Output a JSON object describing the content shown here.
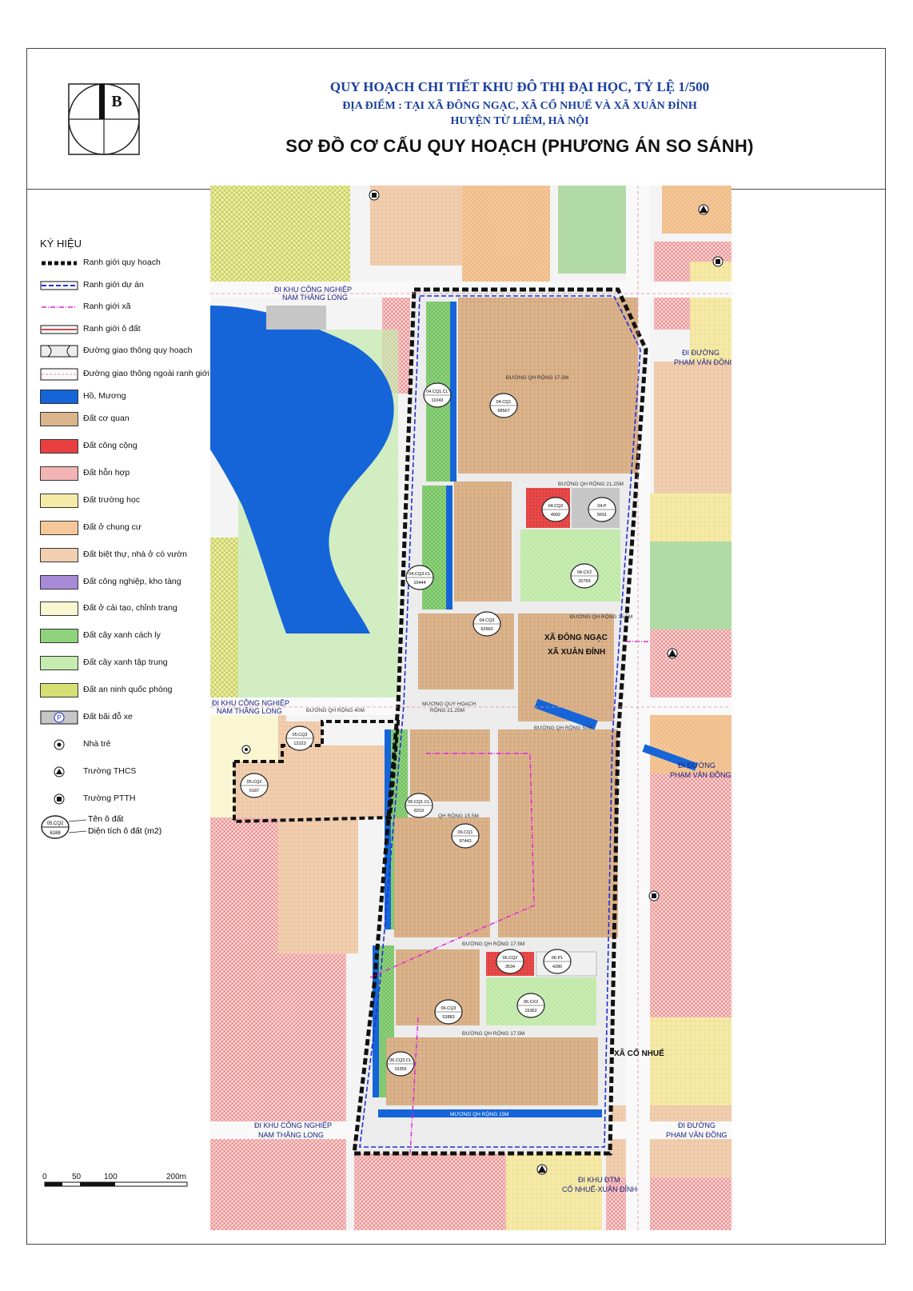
{
  "header": {
    "logo_letter": "B",
    "title_line1": "QUY HOẠCH CHI TIẾT KHU ĐÔ THỊ ĐẠI HỌC, TỶ LỆ 1/500",
    "title_line2": "ĐỊA ĐIỂM : TẠI XÃ ĐÔNG NGẠC, XÃ CỔ NHUẾ VÀ XÃ XUÂN ĐỈNH",
    "title_line3": "HUYỆN TỪ LIÊM, HÀ NỘI",
    "main_title": "SƠ ĐỒ CƠ CẤU QUY HOẠCH (PHƯƠNG ÁN SO SÁNH)"
  },
  "legend": {
    "title": "KÝ HIỆU",
    "items": [
      {
        "label": "Ranh giới quy hoạch",
        "icon": "boundary-planning"
      },
      {
        "label": "Ranh giới dự án",
        "icon": "boundary-project"
      },
      {
        "label": "Ranh giới xã",
        "icon": "boundary-commune"
      },
      {
        "label": "Ranh giới ô đất",
        "icon": "boundary-lot"
      },
      {
        "label": "Đường giao thông quy hoạch",
        "icon": "road-planned"
      },
      {
        "label": "Đường giao thông ngoài ranh giới",
        "icon": "road-outside"
      },
      {
        "label": "Hồ, Mương",
        "icon": "water"
      },
      {
        "label": "Đất cơ quan",
        "icon": "agency-land"
      },
      {
        "label": "Đất công cộng",
        "icon": "public-land"
      },
      {
        "label": "Đất hỗn hợp",
        "icon": "mixed-land"
      },
      {
        "label": "Đất trường học",
        "icon": "school-land"
      },
      {
        "label": "Đất ở chung cư",
        "icon": "apartment-land"
      },
      {
        "label": "Đất biệt thự, nhà ở có vườn",
        "icon": "villa-land"
      },
      {
        "label": "Đất công nghiệp, kho tàng",
        "icon": "industrial-land"
      },
      {
        "label": "Đất ở cải tạo, chỉnh trang",
        "icon": "renovation-land"
      },
      {
        "label": "Đất cây xanh cách ly",
        "icon": "green-buffer"
      },
      {
        "label": "Đất cây xanh tập trung",
        "icon": "green-park"
      },
      {
        "label": "Đất an ninh quốc phòng",
        "icon": "defense-land"
      },
      {
        "label": "Đất bãi đỗ xe",
        "icon": "parking"
      },
      {
        "label": "Nhà trẻ",
        "icon": "kindergarten"
      },
      {
        "label": "Trường THCS",
        "icon": "secondary-school"
      },
      {
        "label": "Trường PTTH",
        "icon": "high-school"
      }
    ],
    "lot_name_label": "Tên ô đất",
    "lot_area_label": "Diện tích ô đất (m2)",
    "sample_name": "05.CQ2",
    "sample_area": "6188"
  },
  "colors": {
    "title_blue": "#1a3f9e",
    "agency": "#dcb48c",
    "public": "#e84040",
    "mixed": "#f2b4b4",
    "school": "#f6eaa8",
    "apartment": "#f4c89a",
    "villa": "#f2cfb0",
    "industrial": "#a98ad8",
    "renovation": "#fbf6d2",
    "green_buffer": "#8ed37c",
    "green_park": "#c6ecb0",
    "defense": "#d6df74",
    "water": "#1565d8",
    "road": "#ececec"
  },
  "map": {
    "lots": [
      {
        "name": "04.CQ1.CL",
        "area": "11043"
      },
      {
        "name": "04.CQ1",
        "area": "68567"
      },
      {
        "name": "04.CQ2",
        "area": "4992"
      },
      {
        "name": "04.P",
        "area": "5691"
      },
      {
        "name": "04.CX2",
        "area": "20769"
      },
      {
        "name": "04.CQ3.CL",
        "area": "10444"
      },
      {
        "name": "04.CQ3",
        "area": "62660"
      },
      {
        "name": "05.CQ3",
        "area": "12223"
      },
      {
        "name": "05.CQ2",
        "area": "6187"
      },
      {
        "name": "06.CQ1.CL",
        "area": "8319"
      },
      {
        "name": "06.CQ1",
        "area": "97443"
      },
      {
        "name": "06.CQ2",
        "area": "3534"
      },
      {
        "name": "06.P1",
        "area": "4280"
      },
      {
        "name": "06.CX2",
        "area": "15362"
      },
      {
        "name": "06.CQ3",
        "area": "53883"
      },
      {
        "name": "06.CQ3.CL",
        "area": "15356"
      }
    ],
    "labels": {
      "to_industrial_1": "ĐI KHU CÔNG NGHIỆP",
      "to_industrial_2": "NAM THĂNG LONG",
      "to_pvd_1": "ĐI ĐƯỜNG",
      "to_pvd_2": "PHẠM VĂN ĐỒNG",
      "to_ktm_1": "ĐI KHU ĐTM",
      "to_ktm_2": "CỔ NHUẾ-XUÂN ĐỈNH",
      "commune_dong_ngac": "XÃ ĐÔNG NGẠC",
      "commune_xuan_dinh": "XÃ XUÂN ĐỈNH",
      "commune_co_nhue": "XÃ CỔ NHUẾ",
      "road_17_5": "ĐƯỜNG QH RỘNG 17.5M",
      "road_21_25": "ĐƯỜNG QH RỘNG 21.25M",
      "road_15_5": "ĐƯỜNG QH RỘNG 15.5M",
      "road_40": "ĐƯỜNG QH RỘNG 40M",
      "road_50": "ĐƯỜNG QH RỘNG 50M",
      "road_30": "ĐƯỜNG QH RỘNG 30M",
      "canal_1": "MƯƠNG QUY HOẠCH",
      "canal_2": "RỘNG 21.25M",
      "canal_15": "MƯƠNG QH RỘNG 15M",
      "qh_15_5": "QH RỘNG 15.5M"
    }
  },
  "scale": {
    "labels": [
      "0",
      "50",
      "100",
      "200m"
    ]
  }
}
